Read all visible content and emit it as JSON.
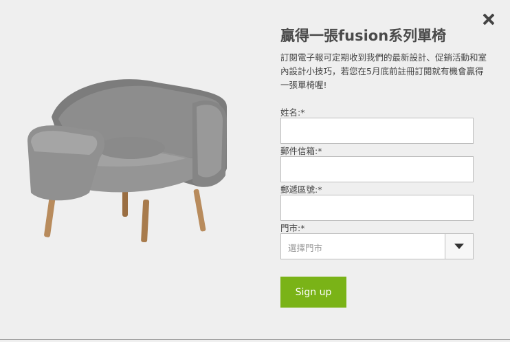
{
  "popup": {
    "title": "贏得一張fusion系列單椅",
    "description": "訂閱電子報可定期收到我們的最新設計、促銷活動和室內設計小技巧，若您在5月底前註冊訂閱就有機會贏得一張單椅喔!"
  },
  "form": {
    "name_label": "姓名:*",
    "email_label": "郵件信箱:*",
    "zip_label": "郵遞區號:*",
    "store_label": "門市:*",
    "store_placeholder": "選擇門市",
    "submit_label": "Sign up"
  },
  "colors": {
    "accent": "#7ab317",
    "background": "#efefef"
  },
  "icons": {
    "close": "close-icon",
    "dropdown": "chevron-down-icon"
  }
}
